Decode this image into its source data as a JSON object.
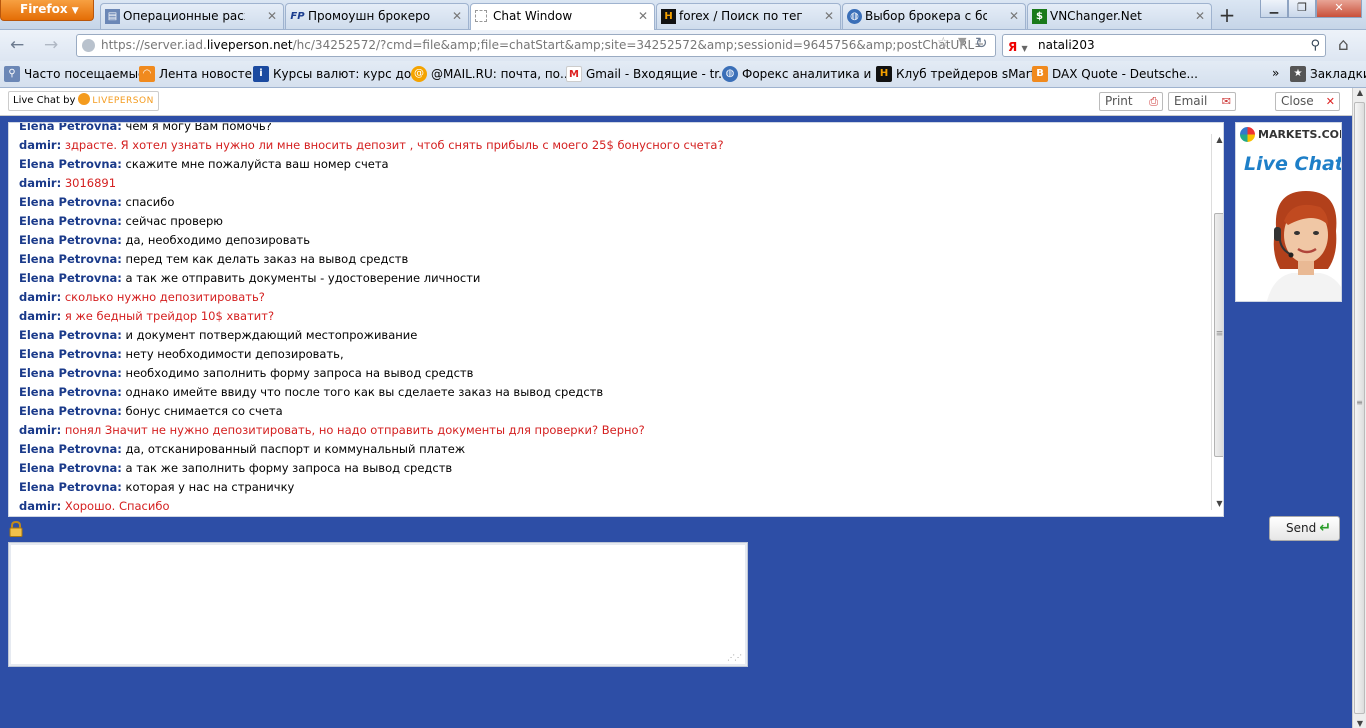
{
  "browser": {
    "menu_label": "Firefox",
    "tabs": [
      {
        "title": "Операционные расход…",
        "favicon": "doc-icon",
        "active": false
      },
      {
        "title": "Промоушн брокеров Ф…",
        "favicon": "fp-icon",
        "active": false
      },
      {
        "title": "Chat Window",
        "favicon": "blank-page-icon",
        "active": true
      },
      {
        "title": "forex / Поиск по тегам /…",
        "favicon": "h-icon",
        "active": false
      },
      {
        "title": "Выбор брокера с бонус…",
        "favicon": "globe-icon",
        "active": false
      },
      {
        "title": "VNChanger.Net",
        "favicon": "dollar-icon",
        "active": false
      }
    ],
    "url_prefix": "https://server.iad.",
    "url_domain": "liveperson.net",
    "url_rest": "/hc/34252572/?cmd=file&amp;file=chatStart&amp;site=34252572&amp;sessionid=9645756&amp;postChatURL=",
    "search_value": "natali203",
    "search_engine": "Я",
    "bookmarks": [
      {
        "label": "Часто посещаемые",
        "icon": "search-icon"
      },
      {
        "label": "Лента новостей",
        "icon": "rss-icon"
      },
      {
        "label": "Курсы валют: курс до...",
        "icon": "info-icon"
      },
      {
        "label": "@MAIL.RU: почта, по...",
        "icon": "mail-ru-icon"
      },
      {
        "label": "Gmail - Входящие - tr...",
        "icon": "gmail-icon"
      },
      {
        "label": "Форекс аналитика и ...",
        "icon": "globe-icon"
      },
      {
        "label": "Клуб трейдеров sMart...",
        "icon": "h-icon"
      },
      {
        "label": "DAX Quote - Deutsche...",
        "icon": "b-icon"
      }
    ],
    "bookmarks_menu": "Закладки"
  },
  "chat_header": {
    "logo_prefix": "Live Chat by",
    "logo_brand": "LIVEPERSON",
    "print_label": "Print",
    "email_label": "Email",
    "close_label": "Close"
  },
  "transcript": {
    "partial_top": {
      "who": "Elena Petrovna:",
      "text": "чем я могу Вам помочь?"
    },
    "messages": [
      {
        "role": "visitor",
        "who": "damir:",
        "text": "здрасте. Я хотел узнать нужно ли мне вносить депозит , чтоб снять прибыль с моего 25$ бонусного счета?"
      },
      {
        "role": "agent",
        "who": "Elena Petrovna:",
        "text": "скажите мне пожалуйста ваш номер счета"
      },
      {
        "role": "visitor",
        "who": "damir:",
        "text": "3016891"
      },
      {
        "role": "agent",
        "who": "Elena Petrovna:",
        "text": "спасибо"
      },
      {
        "role": "agent",
        "who": "Elena Petrovna:",
        "text": "сейчас проверю"
      },
      {
        "role": "agent",
        "who": "Elena Petrovna:",
        "text": "да, необходимо депозировать"
      },
      {
        "role": "agent",
        "who": "Elena Petrovna:",
        "text": "перед тем как делать заказ на вывод средств"
      },
      {
        "role": "agent",
        "who": "Elena Petrovna:",
        "text": "а так же отправить документы - удостоверение личности"
      },
      {
        "role": "visitor",
        "who": "damir:",
        "text": "сколько нужно депозитировать?"
      },
      {
        "role": "visitor",
        "who": "damir:",
        "text": "я же бедный трейдор 10$ хватит?"
      },
      {
        "role": "agent",
        "who": "Elena Petrovna:",
        "text": "и документ потверждающий местопроживание"
      },
      {
        "role": "agent",
        "who": "Elena Petrovna:",
        "text": "нету необходимости депозировать,"
      },
      {
        "role": "agent",
        "who": "Elena Petrovna:",
        "text": "необходимо заполнить форму запроса на вывод средств"
      },
      {
        "role": "agent",
        "who": "Elena Petrovna:",
        "text": "однако имейте ввиду что после того как вы сделаете заказ на вывод средств"
      },
      {
        "role": "agent",
        "who": "Elena Petrovna:",
        "text": "бонус снимается со счета"
      },
      {
        "role": "visitor",
        "who": "damir:",
        "text": "понял Значит не нужно депозитировать, но надо отправить документы для проверки? Верно?"
      },
      {
        "role": "agent",
        "who": "Elena Petrovna:",
        "text": "да, отсканированный паспорт и коммунальный платеж"
      },
      {
        "role": "agent",
        "who": "Elena Petrovna:",
        "text": "а так же заполнить форму запроса на вывод средств"
      },
      {
        "role": "agent",
        "who": "Elena Petrovna:",
        "text": "которая у нас на страничку"
      }
    ],
    "partial_bottom": {
      "who": "damir:",
      "text": "Хорошо. Спасибо"
    }
  },
  "ad": {
    "brand": "MARKETS.COM",
    "headline": "Live Chat"
  },
  "composer": {
    "send_label": "Send",
    "entry_value": ""
  },
  "colors": {
    "page_bg": "#2d4ea6",
    "visitor_text": "#d42020",
    "speaker_name": "#1a3a8a",
    "brand_orange": "#f49b1e"
  }
}
